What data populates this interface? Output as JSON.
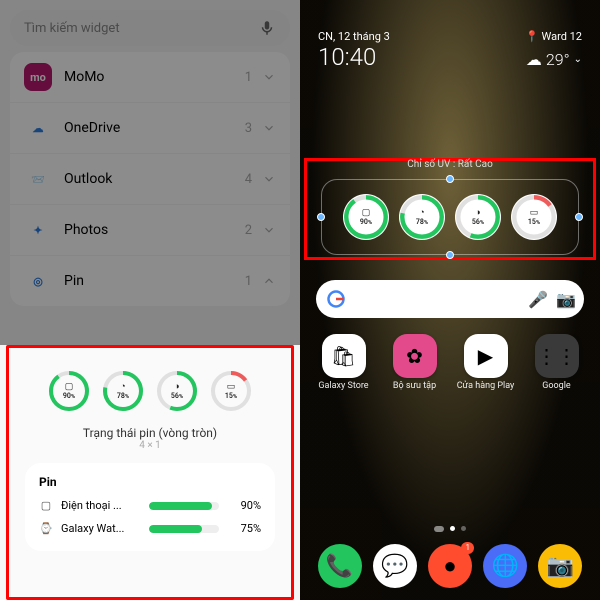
{
  "left": {
    "search_placeholder": "Tìm kiếm widget",
    "apps": [
      {
        "name": "MoMo",
        "count": "1",
        "color": "#b9186f",
        "glyph": "mo",
        "expanded": false
      },
      {
        "name": "OneDrive",
        "count": "3",
        "color": "#fff",
        "glyph": "☁",
        "expanded": false
      },
      {
        "name": "Outlook",
        "count": "4",
        "color": "#fff",
        "glyph": "📨",
        "expanded": false
      },
      {
        "name": "Photos",
        "count": "2",
        "color": "#fff",
        "glyph": "✦",
        "expanded": false
      },
      {
        "name": "Pin",
        "count": "1",
        "color": "#fff",
        "glyph": "◎",
        "expanded": true
      }
    ],
    "rings": [
      {
        "pct": 90,
        "icon": "▢",
        "low": false
      },
      {
        "pct": 78,
        "icon": "◔",
        "low": false
      },
      {
        "pct": 56,
        "icon": "◑",
        "low": false
      },
      {
        "pct": 15,
        "icon": "▭",
        "low": true
      }
    ],
    "widget_title": "Trạng thái pin (vòng tròn)",
    "widget_size": "4 × 1",
    "detail_header": "Pin",
    "devices": [
      {
        "icon": "▢",
        "name": "Điện thoại ...",
        "pct": 90
      },
      {
        "icon": "⌚",
        "name": "Galaxy Wat...",
        "pct": 75
      }
    ]
  },
  "right": {
    "date": "CN, 12 tháng 3",
    "loc": "Ward 12",
    "time": "10:40",
    "temp": "29°",
    "uv": "Chỉ số UV : Rất Cao",
    "rings": [
      {
        "pct": 90,
        "icon": "▢",
        "low": false
      },
      {
        "pct": 78,
        "icon": "◔",
        "low": false
      },
      {
        "pct": 56,
        "icon": "◑",
        "low": false
      },
      {
        "pct": 15,
        "icon": "▭",
        "low": true
      }
    ],
    "apps": [
      {
        "label": "Galaxy Store",
        "bg": "#fff",
        "glyph": "🛍"
      },
      {
        "label": "Bộ sưu tập",
        "bg": "#e24a8b",
        "glyph": "✿"
      },
      {
        "label": "Cửa hàng Play",
        "bg": "#fff",
        "glyph": "▶"
      },
      {
        "label": "Google",
        "bg": "#3a3a3a",
        "glyph": "⋮⋮"
      }
    ],
    "dock": [
      {
        "bg": "#22c55e",
        "glyph": "📞",
        "badge": ""
      },
      {
        "bg": "#fff",
        "glyph": "💬",
        "badge": ""
      },
      {
        "bg": "#ff4b2e",
        "glyph": "●",
        "badge": "1"
      },
      {
        "bg": "#4a6cf7",
        "glyph": "🌐",
        "badge": ""
      },
      {
        "bg": "#fbbc05",
        "glyph": "📷",
        "badge": ""
      }
    ]
  }
}
